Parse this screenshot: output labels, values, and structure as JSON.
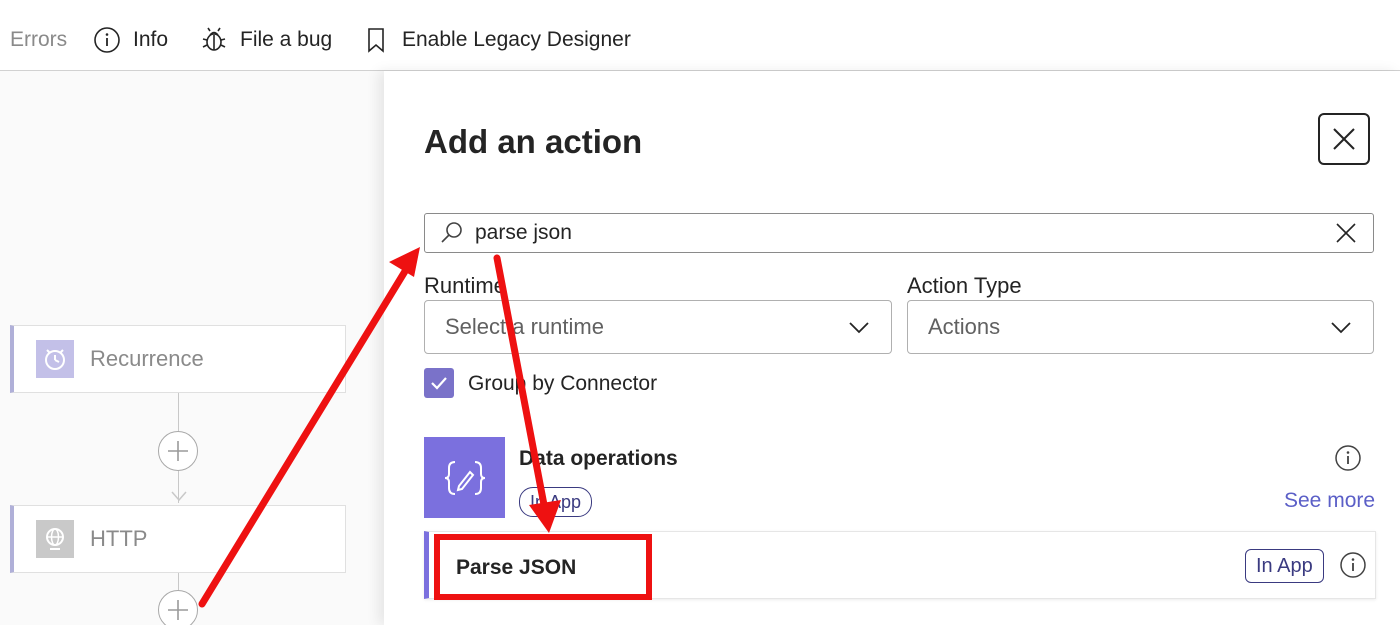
{
  "toolbar": {
    "errors_label": "Errors",
    "info_label": "Info",
    "file_bug_label": "File a bug",
    "legacy_label": "Enable Legacy Designer"
  },
  "canvas": {
    "nodes": [
      {
        "label": "Recurrence",
        "icon": "alarm-clock-icon"
      },
      {
        "label": "HTTP",
        "icon": "globe-icon"
      }
    ]
  },
  "panel": {
    "title": "Add an action",
    "search": {
      "value": "parse json"
    },
    "runtime": {
      "label": "Runtime",
      "placeholder": "Select a runtime"
    },
    "action_type": {
      "label": "Action Type",
      "value": "Actions"
    },
    "group_by": {
      "label": "Group by Connector",
      "checked": true
    },
    "connector": {
      "name": "Data operations",
      "badge": "In App",
      "see_more": "See more",
      "icon": "curly-braces-pencil-icon"
    },
    "action": {
      "name": "Parse JSON",
      "badge": "In App"
    }
  },
  "colors": {
    "accent": "#7b70de",
    "annotation": "#ee1111",
    "link": "#5b5fc7"
  }
}
